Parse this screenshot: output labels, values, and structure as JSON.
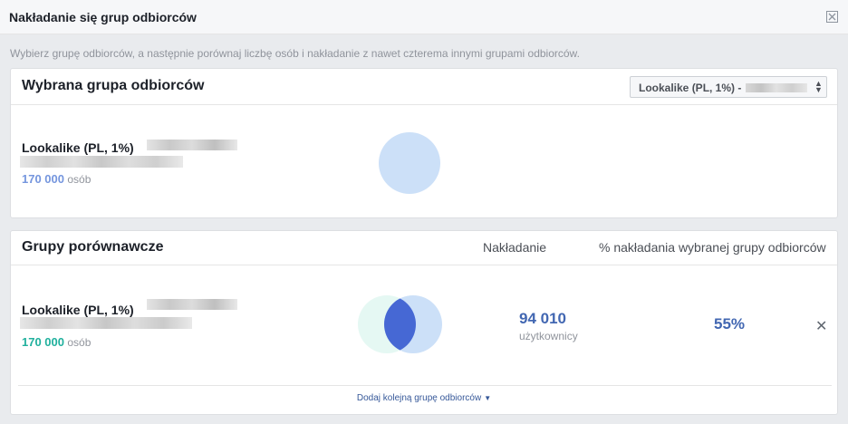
{
  "dialog": {
    "title": "Nakładanie się grup odbiorców",
    "close_icon": "close-icon",
    "intro": "Wybierz grupę odbiorców, a następnie porównaj liczbę osób i nakładanie z nawet czterema innymi grupami odbiorców."
  },
  "selected": {
    "title": "Wybrana grupa odbiorców",
    "select_value": "Lookalike (PL, 1%) -",
    "audience_name": "Lookalike (PL, 1%)",
    "count": "170 000",
    "count_unit": "osób",
    "circle_color": "#cce0f8"
  },
  "comparison": {
    "title": "Grupy porównawcze",
    "col_overlap": "Nakładanie",
    "col_percent": "% nakładania wybranej grupy odbiorców",
    "rows": [
      {
        "audience_name": "Lookalike (PL, 1%)",
        "count": "170 000",
        "count_unit": "osób",
        "overlap_value": "94 010",
        "overlap_unit": "użytkownicy",
        "overlap_percent": "55%"
      }
    ],
    "remove_icon": "close-icon",
    "add_label": "Dodaj kolejną grupę odbiorców"
  },
  "colors": {
    "accent": "#4267b2",
    "selected_count": "#7596de",
    "comparison_count": "#20b09d",
    "venn_left": "#e5f8f3",
    "venn_right": "#cce0f8",
    "venn_overlap": "#4668d4"
  }
}
